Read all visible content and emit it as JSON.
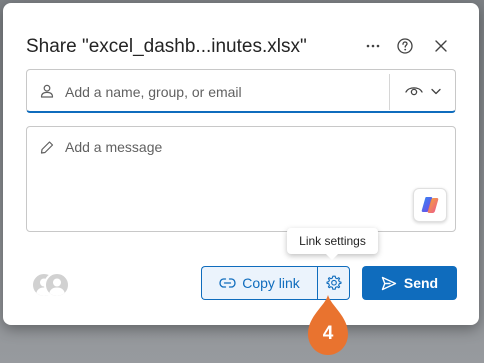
{
  "dialog": {
    "title": "Share \"excel_dashb...inutes.xlsx\"",
    "more_icon": "more-horizontal-icon",
    "help_icon": "help-circle-icon",
    "close_icon": "close-icon"
  },
  "recipients": {
    "placeholder": "Add a name, group, or email",
    "value": "",
    "permission_icon": "eye-icon"
  },
  "message": {
    "placeholder": "Add a message",
    "value": "",
    "copilot_icon": "copilot-icon"
  },
  "footer": {
    "copy_link_label": "Copy link",
    "link_settings_tooltip": "Link settings",
    "send_label": "Send"
  },
  "annotation": {
    "step_number": "4"
  },
  "colors": {
    "accent": "#0f6cbd",
    "accent_light": "#ebf3fc",
    "marker": "#e9732f"
  }
}
